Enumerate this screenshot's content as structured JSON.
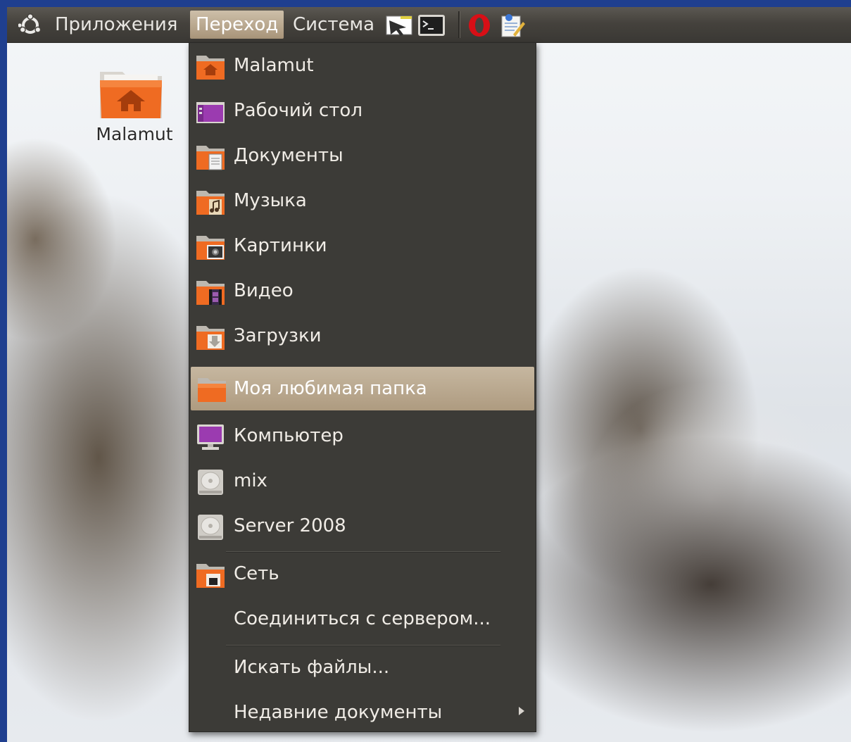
{
  "panel": {
    "apps_label": "Приложения",
    "places_label": "Переход",
    "system_label": "Система",
    "launchers": [
      "screenshot-tool-icon",
      "terminal-icon",
      "opera-icon",
      "text-editor-icon"
    ]
  },
  "desktop": {
    "home_icon_label": "Malamut"
  },
  "menu": {
    "items": [
      {
        "label": "Malamut",
        "icon": "home-folder-icon"
      },
      {
        "label": "Рабочий стол",
        "icon": "desktop-folder-icon"
      },
      {
        "label": "Документы",
        "icon": "documents-folder-icon"
      },
      {
        "label": "Музыка",
        "icon": "music-folder-icon"
      },
      {
        "label": "Картинки",
        "icon": "pictures-folder-icon"
      },
      {
        "label": "Видео",
        "icon": "videos-folder-icon"
      },
      {
        "label": "Загрузки",
        "icon": "downloads-folder-icon"
      },
      {
        "label": "Моя любимая папка",
        "icon": "folder-icon"
      },
      {
        "label": "Компьютер",
        "icon": "computer-icon"
      },
      {
        "label": "mix",
        "icon": "drive-icon"
      },
      {
        "label": "Server 2008",
        "icon": "drive-icon"
      },
      {
        "label": "Сеть",
        "icon": "network-folder-icon"
      },
      {
        "label": "Соединиться с сервером...",
        "icon": ""
      },
      {
        "label": "Искать файлы...",
        "icon": ""
      },
      {
        "label": "Недавние документы",
        "icon": ""
      }
    ],
    "highlighted_item": "Моя любимая папка"
  },
  "colors": {
    "panel_bg": "#45423d",
    "menu_bg": "#3c3b37",
    "highlight": "#b9a98f",
    "folder_orange": "#e8631c",
    "border_blue": "#1f3f8f"
  }
}
